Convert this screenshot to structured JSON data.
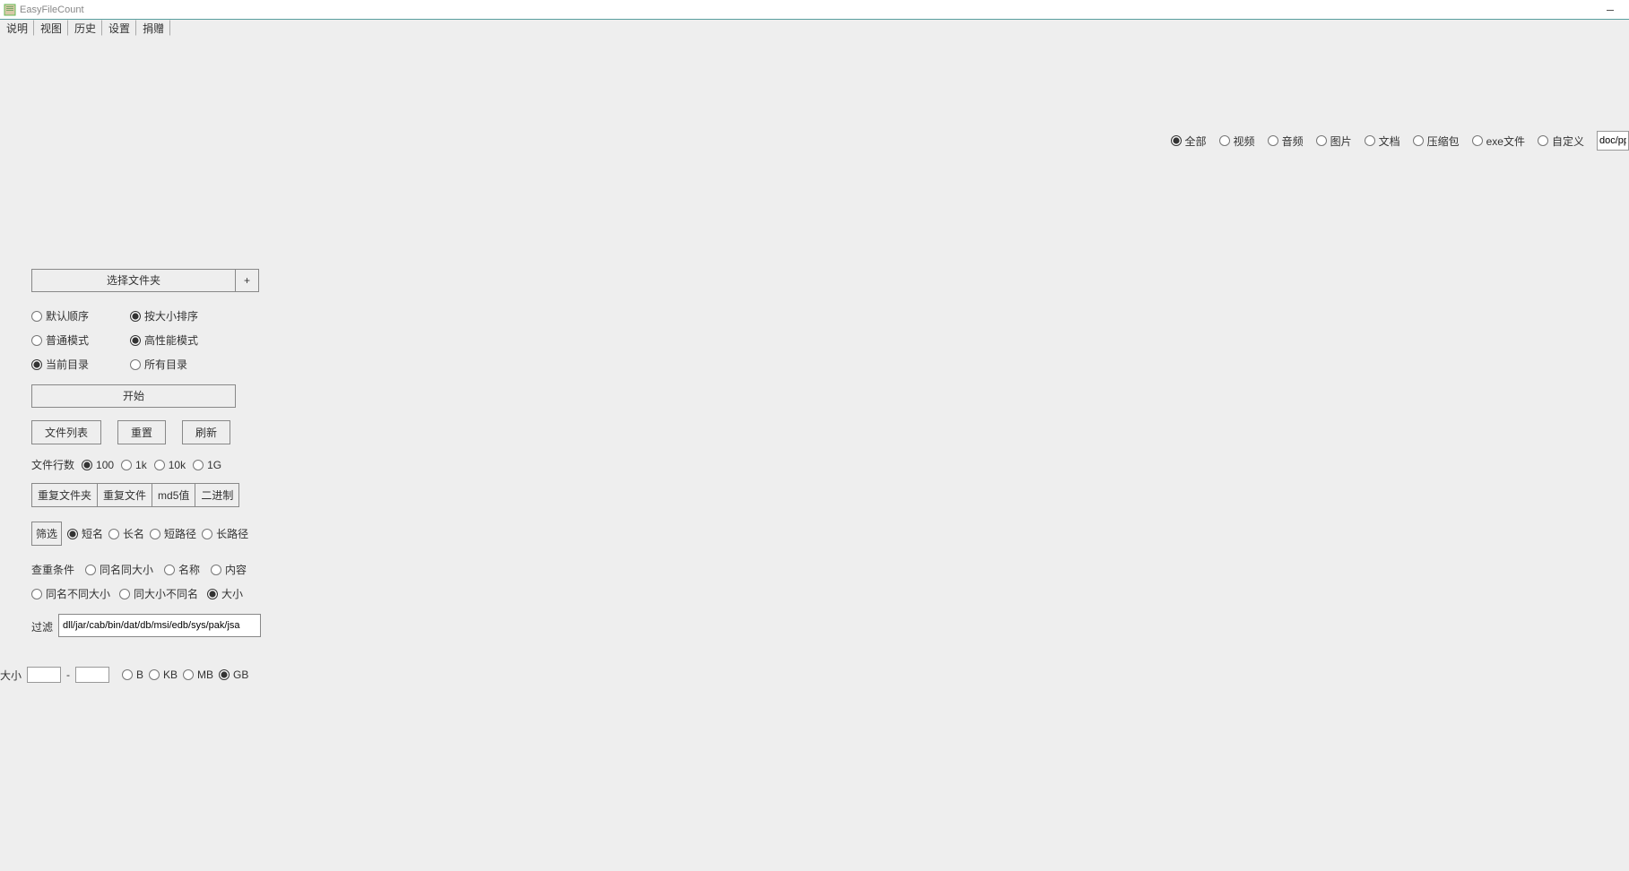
{
  "titlebar": {
    "title": "EasyFileCount"
  },
  "menu": {
    "items": [
      "说明",
      "视图",
      "历史",
      "设置",
      "捐赠"
    ]
  },
  "filetype": {
    "options": [
      "全部",
      "视频",
      "音频",
      "图片",
      "文档",
      "压缩包",
      "exe文件",
      "自定义"
    ],
    "selected": 0,
    "custom_ext": "doc/pp"
  },
  "panel": {
    "select_folder": "选择文件夹",
    "plus": "+",
    "sort": {
      "default_order": "默认顺序",
      "by_size": "按大小排序",
      "selected": 1
    },
    "mode": {
      "normal": "普通模式",
      "high_perf": "高性能模式",
      "selected": 1
    },
    "dir_scope": {
      "current": "当前目录",
      "all": "所有目录",
      "selected": 0
    },
    "start": "开始",
    "actions": {
      "file_list": "文件列表",
      "reset": "重置",
      "refresh": "刷新"
    },
    "row_count": {
      "label": "文件行数",
      "options": [
        "100",
        "1k",
        "10k",
        "1G"
      ],
      "selected": 0
    },
    "dup_buttons": [
      "重复文件夹",
      "重复文件",
      "md5值",
      "二进制"
    ],
    "filter_btn": "筛选",
    "name_length": {
      "options": [
        "短名",
        "长名",
        "短路径",
        "长路径"
      ],
      "selected": 0
    },
    "dup_cond": {
      "label": "查重条件",
      "row1": [
        "同名同大小",
        "名称",
        "内容"
      ],
      "row2": [
        "同名不同大小",
        "同大小不同名",
        "大小"
      ],
      "selected_row2": 2
    },
    "filter_label": "过滤",
    "filter_value": "dll/jar/cab/bin/dat/db/msi/edb/sys/pak/jsa"
  },
  "size_filter": {
    "label": "大小",
    "min": "",
    "max": "",
    "units": [
      "B",
      "KB",
      "MB",
      "GB"
    ],
    "selected": 3
  }
}
